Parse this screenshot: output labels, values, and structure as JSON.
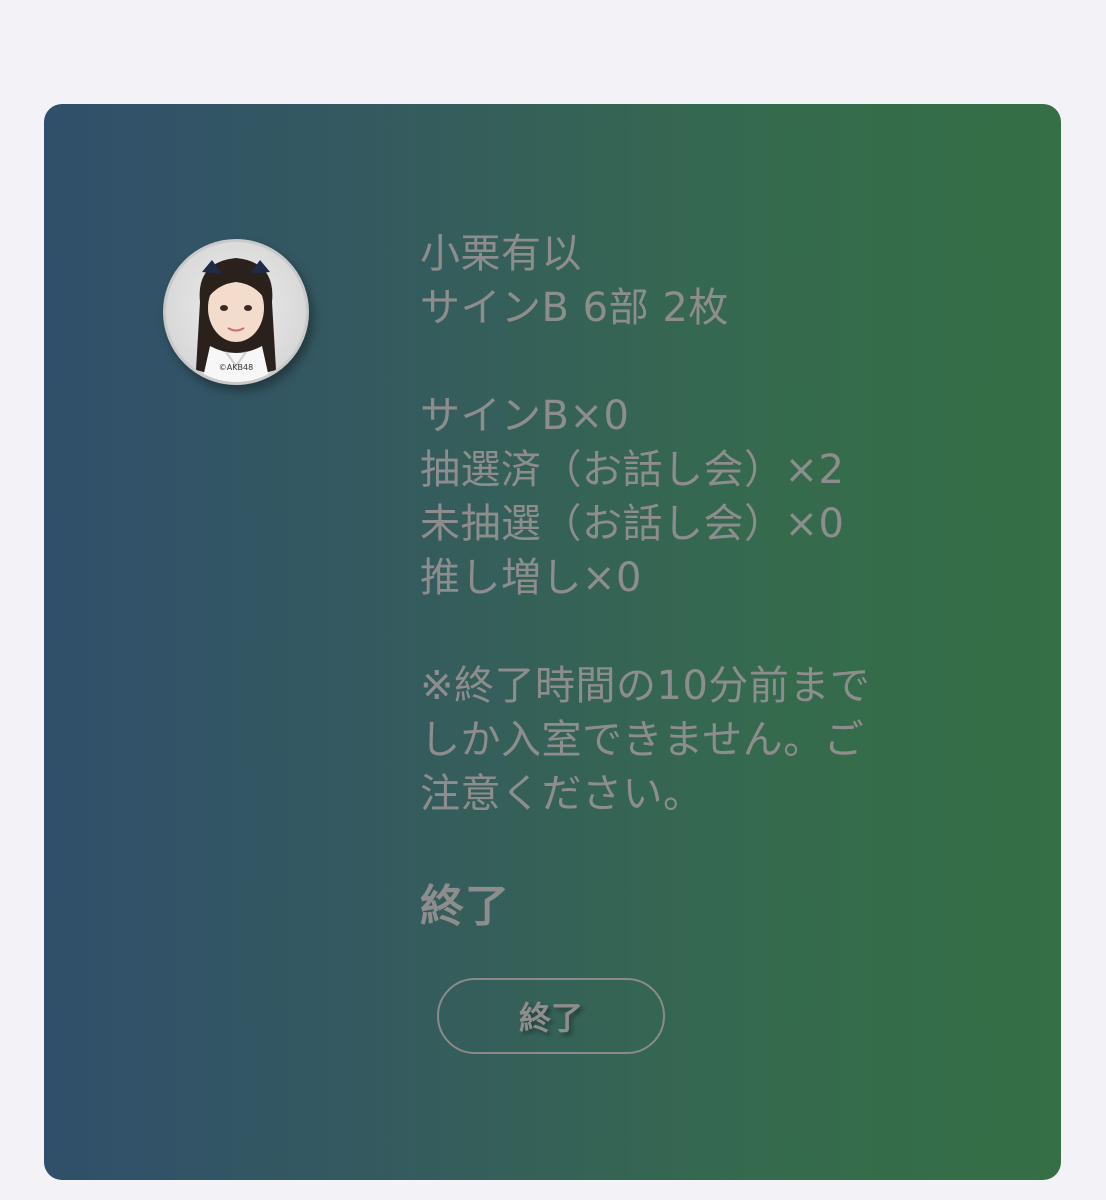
{
  "member": {
    "name": "小栗有以",
    "session": "サインB 6部 2枚",
    "photo_credit": "©AKB48"
  },
  "ticket_counts": [
    "サインB×0",
    "抽選済（お話し会）×2",
    "未抽選（お話し会）×0",
    "推し増し×0"
  ],
  "notice": [
    "※終了時間の10分前まで",
    "しか入室できません。ご",
    "注意ください。"
  ],
  "status": "終了",
  "end_button_label": "終了"
}
